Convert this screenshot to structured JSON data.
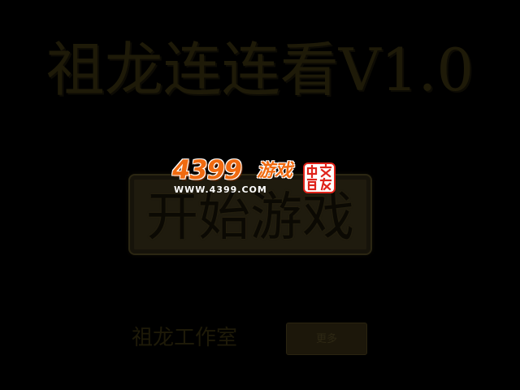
{
  "game": {
    "title": "祖龙连连看V1.0",
    "start_button_label": "开始游戏",
    "studio_name": "祖龙工作室",
    "secondary_button_label": "更多"
  },
  "logo": {
    "brand_number": "4399",
    "brand_word": "游戏",
    "url": "WWW.4399.COM",
    "seal_text": "中文首发"
  },
  "colors": {
    "background": "#000000",
    "dim_text": "#1e1a08",
    "button_fill": "#1f1b0e",
    "logo_orange": "#f06a10",
    "seal_red": "#e0241b"
  }
}
